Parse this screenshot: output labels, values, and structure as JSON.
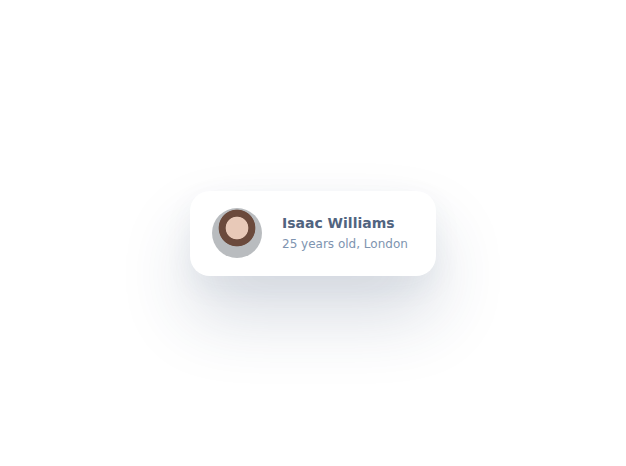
{
  "profile": {
    "name": "Isaac Williams",
    "details": "25 years old, London"
  }
}
